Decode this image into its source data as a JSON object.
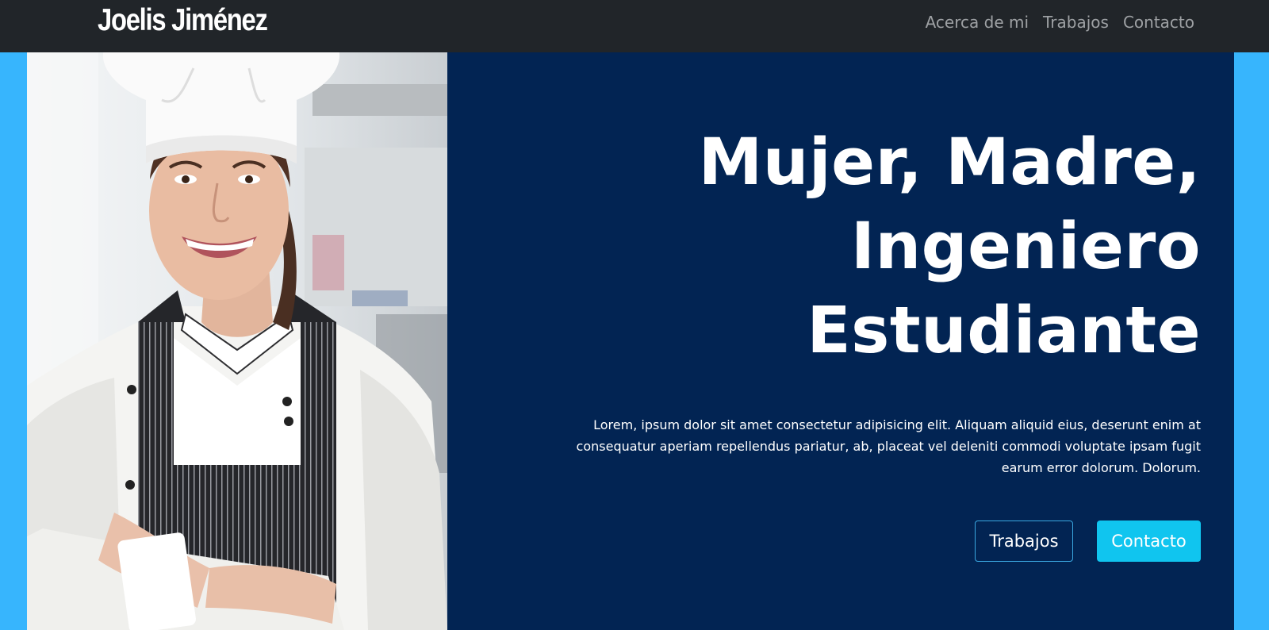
{
  "navbar": {
    "brand": "Joelis Jiménez",
    "links": [
      "Acerca de mi",
      "Trabajos",
      "Contacto"
    ]
  },
  "hero": {
    "image": "Smiling chef woman with white chef hat and striped apron, arms crossed, in a kitchen",
    "title_lines": [
      "Mujer, Madre,",
      "Ingeniero",
      "Estudiante"
    ],
    "paragraph": "Lorem, ipsum dolor sit amet consectetur adipisicing elit. Aliquam aliquid eius, deserunt enim at consequatur aperiam repellendus pariatur, ab, placeat vel deleniti commodi voluptate ipsam fugit earum error dolorum. Dolorum.",
    "buttons": {
      "primary": "Trabajos",
      "secondary": "Contacto"
    }
  },
  "colors": {
    "navbar_bg": "#212529",
    "side_accent": "#37b5fd",
    "hero_bg": "#022453",
    "button_cyan": "#10c5ef"
  }
}
